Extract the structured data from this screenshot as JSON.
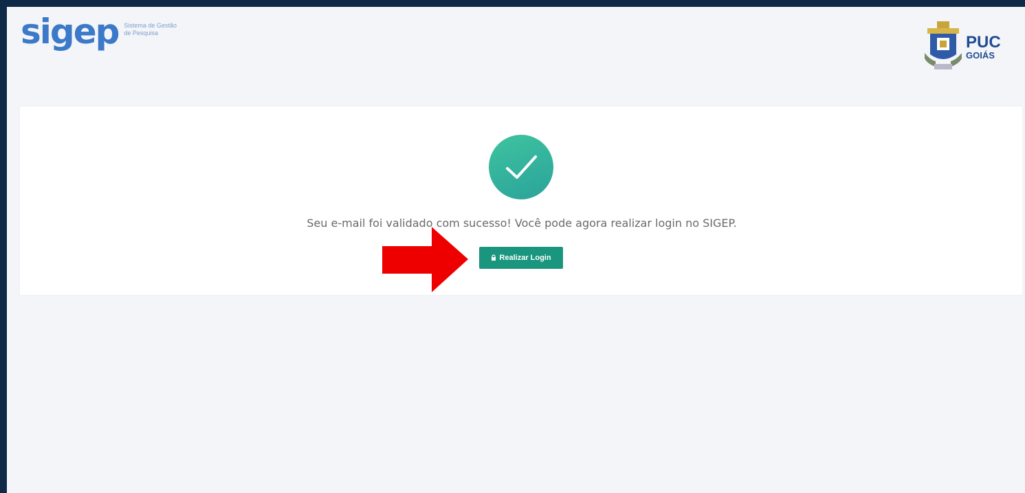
{
  "header": {
    "brand": "sigep",
    "brand_sub_line1": "Sistema de Gestão",
    "brand_sub_line2": "de Pesquisa",
    "institution_line1": "PUC",
    "institution_line2": "GOIÁS"
  },
  "main": {
    "status_icon": "checkmark-icon",
    "message": "Seu e-mail foi validado com sucesso! Você pode agora realizar login no SIGEP.",
    "login_button_label": "Realizar Login",
    "login_button_icon": "lock-icon"
  },
  "annotation": {
    "arrow": "red-arrow"
  },
  "colors": {
    "background": "#f3f5f8",
    "outer_frame": "#0f2a46",
    "brand": "#3c79c8",
    "success_circle": "#2fb39c",
    "button": "#1a967f",
    "arrow": "#ee0000",
    "text": "#676a6c"
  }
}
